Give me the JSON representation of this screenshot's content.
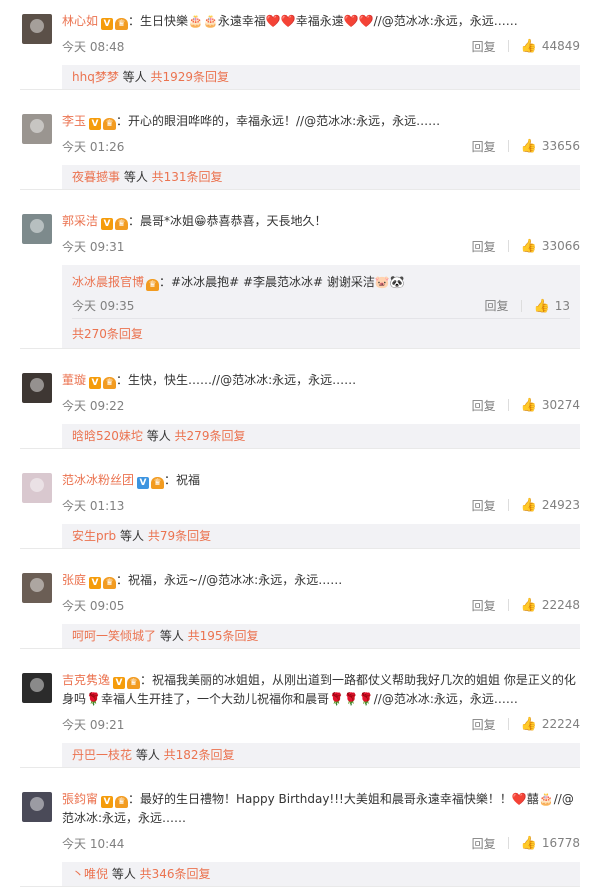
{
  "colors": {
    "accent": "#eb7350",
    "link": "#eb7350",
    "text": "#333333",
    "muted": "#808080",
    "reply_bg": "#f2f2f5"
  },
  "icons": {
    "like": "thumb-up-icon",
    "vip": "verified-v-icon",
    "crown": "vip-crown-icon"
  },
  "ui": {
    "reply_label": "回复"
  },
  "comments": [
    {
      "user": "林心如",
      "body": "：生日快樂🎂🎂永遠幸福❤️❤️幸福永遠❤️❤️//@范冰冰:永远，永远……",
      "time": "今天 08:48",
      "likes": "44849",
      "replies": {
        "names": "hhq梦梦",
        "sep": " 等人 ",
        "count": "共1929条回复"
      }
    },
    {
      "user": "李玉",
      "body": "：开心的眼泪哗哗的，幸福永远！//@范冰冰:永远，永远……",
      "time": "今天 01:26",
      "likes": "33656",
      "replies": {
        "names": "夜暮撼事",
        "sep": " 等人 ",
        "count": "共131条回复"
      }
    },
    {
      "user": "郭采洁",
      "body": "：晨哥*冰姐😁恭喜恭喜，天長地久！",
      "time": "今天 09:31",
      "likes": "33066",
      "sub": {
        "user": "冰冰晨报官博",
        "body": "：#冰冰晨抱# #李晨范冰冰# 谢谢采洁🐷🐼",
        "time": "今天 09:35",
        "likes": "13"
      },
      "replies": {
        "count": "共270条回复"
      }
    },
    {
      "user": "董璇",
      "body": "：生快，快生……//@范冰冰:永远，永远……",
      "time": "今天 09:22",
      "likes": "30274",
      "replies": {
        "names": "晗晗520妹坨",
        "sep": " 等人 ",
        "count": "共279条回复"
      }
    },
    {
      "user": "范冰冰粉丝团",
      "body": "：祝福",
      "time": "今天 01:13",
      "likes": "24923",
      "replies": {
        "names": "安生prb",
        "sep": " 等人 ",
        "count": "共79条回复"
      }
    },
    {
      "user": "张庭",
      "body": "：祝福，永远~//@范冰冰:永远，永远……",
      "time": "今天 09:05",
      "likes": "22248",
      "replies": {
        "names": "呵呵一笑倾城了",
        "sep": " 等人 ",
        "count": "共195条回复"
      }
    },
    {
      "user": "吉克隽逸",
      "body": "：祝福我美丽的冰姐姐，从刚出道到一路都仗义帮助我好几次的姐姐 你是正义的化身吗🌹幸福人生开挂了，一个大劲儿祝福你和晨哥🌹🌹🌹//@范冰冰:永远，永远……",
      "time": "今天 09:21",
      "likes": "22224",
      "replies": {
        "names": "丹巴一枝花",
        "sep": " 等人 ",
        "count": "共182条回复"
      }
    },
    {
      "user": "張鈞甯",
      "body": "：最好的生日禮物！Happy Birthday!!!大美姐和晨哥永遠幸福快樂！！❤️囍🎂//@范冰冰:永远，永远……",
      "time": "今天 10:44",
      "likes": "16778",
      "replies": {
        "names": "丶唯倪",
        "sep": " 等人 ",
        "count": "共346条回复"
      }
    }
  ]
}
